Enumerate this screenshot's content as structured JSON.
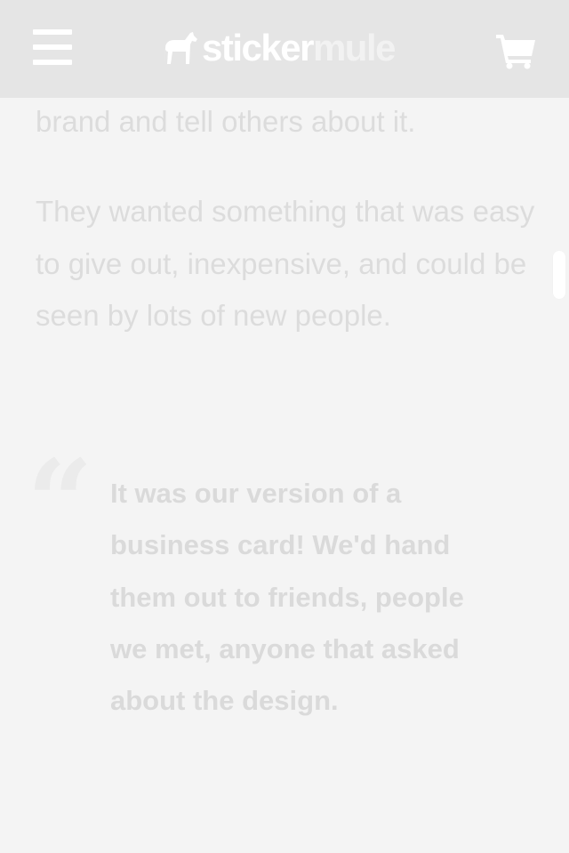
{
  "header": {
    "logo_sticker": "sticker",
    "logo_mule": "mule",
    "menu_icon": "hamburger-menu-icon",
    "cart_icon": "shopping-cart-icon"
  },
  "content": {
    "para1": "brand and tell others about it.",
    "para2": "They wanted something that was easy to give out, inexpensive, and could be seen by lots of new people.",
    "quote": "It was our version of a business card! We'd hand them out to friends, people we met, anyone that asked about the design."
  },
  "colors": {
    "header_bg": "#e5e5e5",
    "page_bg": "#f4f4f4",
    "text": "#dcdcdc"
  }
}
